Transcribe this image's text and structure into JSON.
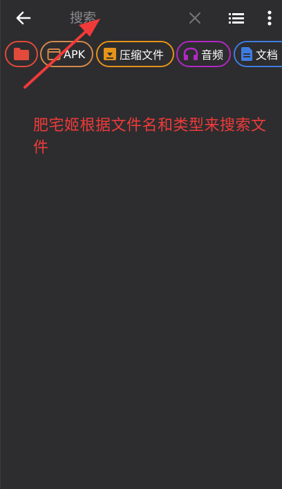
{
  "toolbar": {
    "back_icon": "arrow-left-icon",
    "search_placeholder": "搜索",
    "search_value": "",
    "clear_icon": "close-icon",
    "list_icon": "list-view-icon",
    "more_icon": "more-vertical-icon"
  },
  "filters": [
    {
      "label": "",
      "icon": "folder-icon",
      "color": "#e24a3b"
    },
    {
      "label": "APK",
      "icon": "apk-icon",
      "color": "#d5894a"
    },
    {
      "label": "压缩文件",
      "icon": "archive-icon",
      "color": "#e5941a"
    },
    {
      "label": "音频",
      "icon": "headphones-icon",
      "color": "#b228c4"
    },
    {
      "label": "文档",
      "icon": "document-icon",
      "color": "#3f7ce0"
    }
  ],
  "annotation": {
    "text": "肥宅姬根据文件名和类型来搜索文件",
    "color": "#f03a3a"
  },
  "colors": {
    "background": "#2d2d2f",
    "caret": "#4db6ac",
    "placeholder": "#8b8b8f"
  }
}
